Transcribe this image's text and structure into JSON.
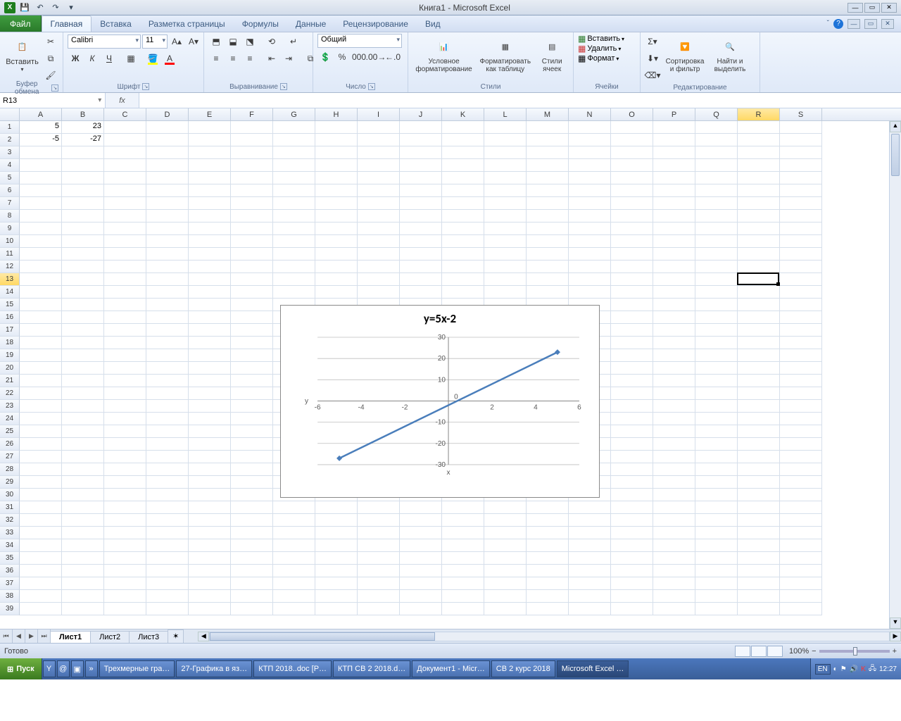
{
  "window": {
    "title": "Книга1 - Microsoft Excel"
  },
  "qat": [
    "save",
    "undo",
    "redo"
  ],
  "tabs": {
    "file": "Файл",
    "items": [
      "Главная",
      "Вставка",
      "Разметка страницы",
      "Формулы",
      "Данные",
      "Рецензирование",
      "Вид"
    ],
    "active": 0
  },
  "ribbon": {
    "clipboard": {
      "paste": "Вставить",
      "label": "Буфер обмена"
    },
    "font": {
      "name": "Calibri",
      "size": "11",
      "label": "Шрифт"
    },
    "alignment": {
      "label": "Выравнивание"
    },
    "number": {
      "format": "Общий",
      "label": "Число"
    },
    "styles": {
      "conditional": "Условное форматирование",
      "table": "Форматировать как таблицу",
      "cellstyles": "Стили ячеек",
      "label": "Стили"
    },
    "cells": {
      "insert": "Вставить",
      "delete": "Удалить",
      "format": "Формат",
      "label": "Ячейки"
    },
    "editing": {
      "sort": "Сортировка и фильтр",
      "find": "Найти и выделить",
      "label": "Редактирование"
    }
  },
  "namebox": "R13",
  "formula": "",
  "columns": [
    "A",
    "B",
    "C",
    "D",
    "E",
    "F",
    "G",
    "H",
    "I",
    "J",
    "K",
    "L",
    "M",
    "N",
    "O",
    "P",
    "Q",
    "R",
    "S"
  ],
  "row_count": 39,
  "active_col": "R",
  "active_row": 13,
  "cells": {
    "A1": "5",
    "B1": "23",
    "A2": "-5",
    "B2": "-27"
  },
  "chart_data": {
    "type": "line",
    "title": "y=5x-2",
    "xlabel": "x",
    "ylabel": "y",
    "x": [
      -5,
      5
    ],
    "y": [
      -27,
      23
    ],
    "xlim": [
      -6,
      6
    ],
    "ylim": [
      -30,
      30
    ],
    "xticks": [
      -6,
      -4,
      -2,
      0,
      2,
      4,
      6
    ],
    "yticks": [
      -30,
      -20,
      -10,
      0,
      10,
      20,
      30
    ],
    "series_color": "#4a7ebb"
  },
  "sheets": {
    "items": [
      "Лист1",
      "Лист2",
      "Лист3"
    ],
    "active": 0
  },
  "status": {
    "ready": "Готово",
    "zoom": "100%"
  },
  "taskbar": {
    "start": "Пуск",
    "items": [
      "Трехмерные гра…",
      "27-Графика в яз…",
      "КТП 2018..doc [Р…",
      "КТП СВ 2 2018.d…",
      "Документ1 - Micr…",
      "СВ 2 курс 2018",
      "Microsoft Excel …"
    ],
    "active_item": 6,
    "lang": "EN",
    "time": "12:27"
  }
}
